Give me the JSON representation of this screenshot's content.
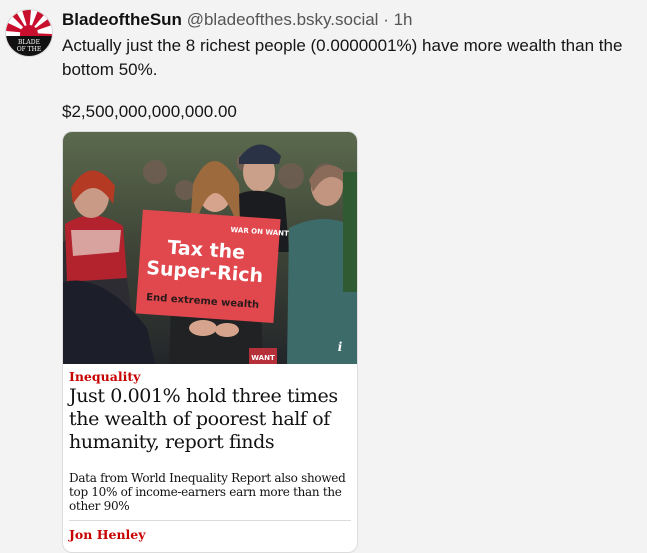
{
  "post": {
    "display_name": "BladeoftheSun",
    "handle": "@bladeofthes.bsky.social",
    "separator": "·",
    "time": "1h",
    "text": "Actually just the 8 richest people (0.0000001%) have more wealth than the bottom 50%.",
    "amount": "$2,500,000,000,000.00"
  },
  "avatar": {
    "line1": "BLADE",
    "line2": "OF THE",
    "accent": "#c8102e"
  },
  "card": {
    "photo": {
      "sign_brand": "WAR ON WANT",
      "sign_line1": "Tax the",
      "sign_line2": "Super-Rich",
      "sign_line3": "End extreme wealth",
      "sign_color": "#e0484e",
      "bottom_badge": "WANT",
      "info_glyph": "i"
    },
    "section": "Inequality",
    "headline": "Just 0.001% hold three times the wealth of poorest half of humanity, report finds",
    "standfirst": "Data from World Inequality Report also showed top 10% of income-earners earn more than the other 90%",
    "byline": "Jon Henley",
    "accent": "#c70000"
  }
}
